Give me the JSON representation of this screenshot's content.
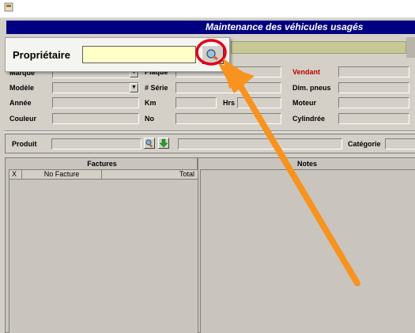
{
  "window": {
    "title": "Maintenance des véhicules usagés"
  },
  "owner": {
    "label": "Propriétaire",
    "value": "",
    "search_icon": "search-magnifier-icon"
  },
  "vehicle_form": {
    "left": [
      {
        "label": "Marque",
        "value": ""
      },
      {
        "label": "Modèle",
        "value": ""
      },
      {
        "label": "Année",
        "value": ""
      },
      {
        "label": "Couleur",
        "value": ""
      }
    ],
    "middle": [
      {
        "label": "Plaque",
        "value": ""
      },
      {
        "label": "# Série",
        "value": ""
      },
      {
        "label": "Km",
        "value": ""
      },
      {
        "label": "No",
        "value": ""
      }
    ],
    "hrs_label": "Hrs",
    "right": [
      {
        "label": "Vendant",
        "value": ""
      },
      {
        "label": "Dim. pneus",
        "value": ""
      },
      {
        "label": "Moteur",
        "value": ""
      },
      {
        "label": "Cylindrée",
        "value": ""
      }
    ]
  },
  "product": {
    "label": "Produit",
    "category_label": "Catégorie"
  },
  "invoices": {
    "title": "Factures",
    "columns": [
      "X",
      "No Facture",
      "Total"
    ]
  },
  "notes": {
    "title": "Notes"
  },
  "colors": {
    "title_bar": "#000080",
    "arrow": "#f7931e",
    "highlight_circle": "#e0001a",
    "owner_input": "#ffffc8"
  }
}
